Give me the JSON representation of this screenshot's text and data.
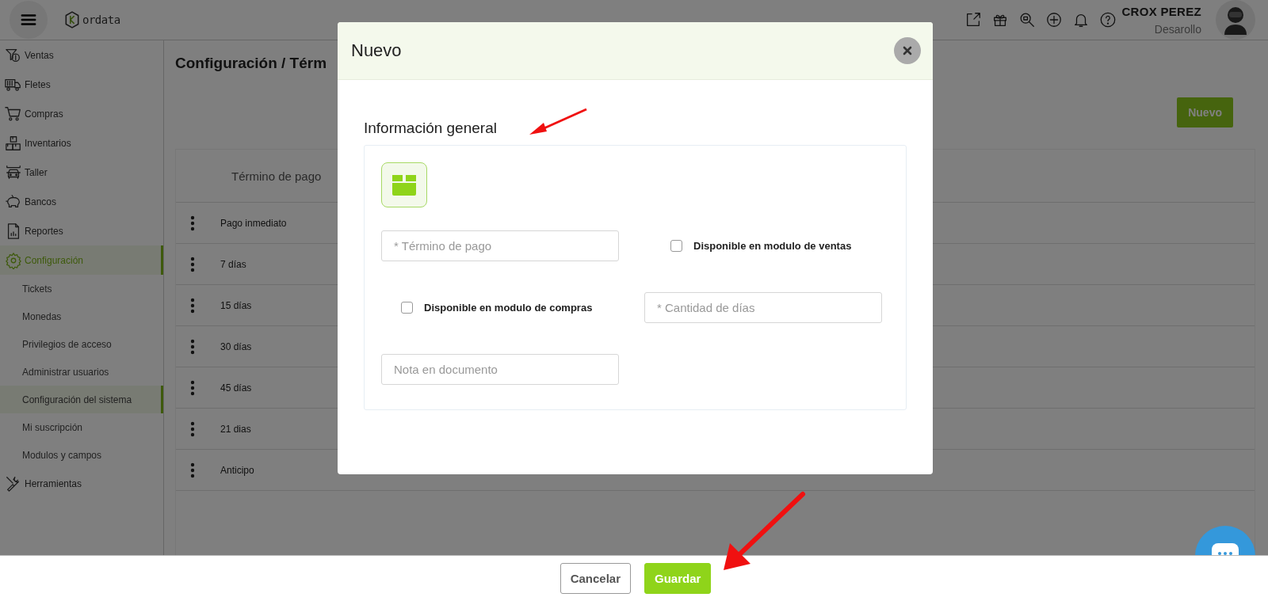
{
  "header": {
    "logo": "ordata",
    "user_name": "CROX PEREZ",
    "user_role": "Desarollo"
  },
  "sidebar": {
    "items": [
      {
        "label": "Ventas",
        "selected": false
      },
      {
        "label": "Fletes",
        "selected": false
      },
      {
        "label": "Compras",
        "selected": false
      },
      {
        "label": "Inventarios",
        "selected": false
      },
      {
        "label": "Taller",
        "selected": false
      },
      {
        "label": "Bancos",
        "selected": false
      },
      {
        "label": "Reportes",
        "selected": false
      },
      {
        "label": "Configuración",
        "selected": true,
        "children": [
          {
            "label": "Tickets",
            "selected": false
          },
          {
            "label": "Monedas",
            "selected": false
          },
          {
            "label": "Privilegios de acceso",
            "selected": false
          },
          {
            "label": "Administrar usuarios",
            "selected": false
          },
          {
            "label": "Configuración del sistema",
            "selected": true
          },
          {
            "label": "Mi suscripción",
            "selected": false
          },
          {
            "label": "Modulos y campos",
            "selected": false
          }
        ]
      },
      {
        "label": "Herramientas",
        "selected": false
      }
    ]
  },
  "page": {
    "breadcrumb": "Configuración /  Térm",
    "new_button": "Nuevo"
  },
  "table": {
    "columns": [
      "Término de pago"
    ],
    "rows": [
      [
        "Pago inmediato"
      ],
      [
        "7 días"
      ],
      [
        "15 días"
      ],
      [
        "30 días"
      ],
      [
        "45 días"
      ],
      [
        "21 dias"
      ],
      [
        "Anticipo"
      ]
    ]
  },
  "modal": {
    "title": "Nuevo",
    "section_title": "Información general",
    "fields": [
      {
        "kind": "input",
        "placeholder": "* Término de pago"
      },
      {
        "kind": "checkbox",
        "label": "Disponible en modulo de ventas",
        "checked": false
      },
      {
        "kind": "checkbox",
        "label": "Disponible en modulo de compras",
        "checked": false
      },
      {
        "kind": "input",
        "placeholder": "* Cantidad de días"
      },
      {
        "kind": "input",
        "placeholder": "Nota en documento"
      }
    ]
  },
  "footer": {
    "buttons": [
      {
        "label": "Cancelar",
        "kind": "secondary"
      },
      {
        "label": "Guardar",
        "kind": "primary"
      }
    ]
  }
}
